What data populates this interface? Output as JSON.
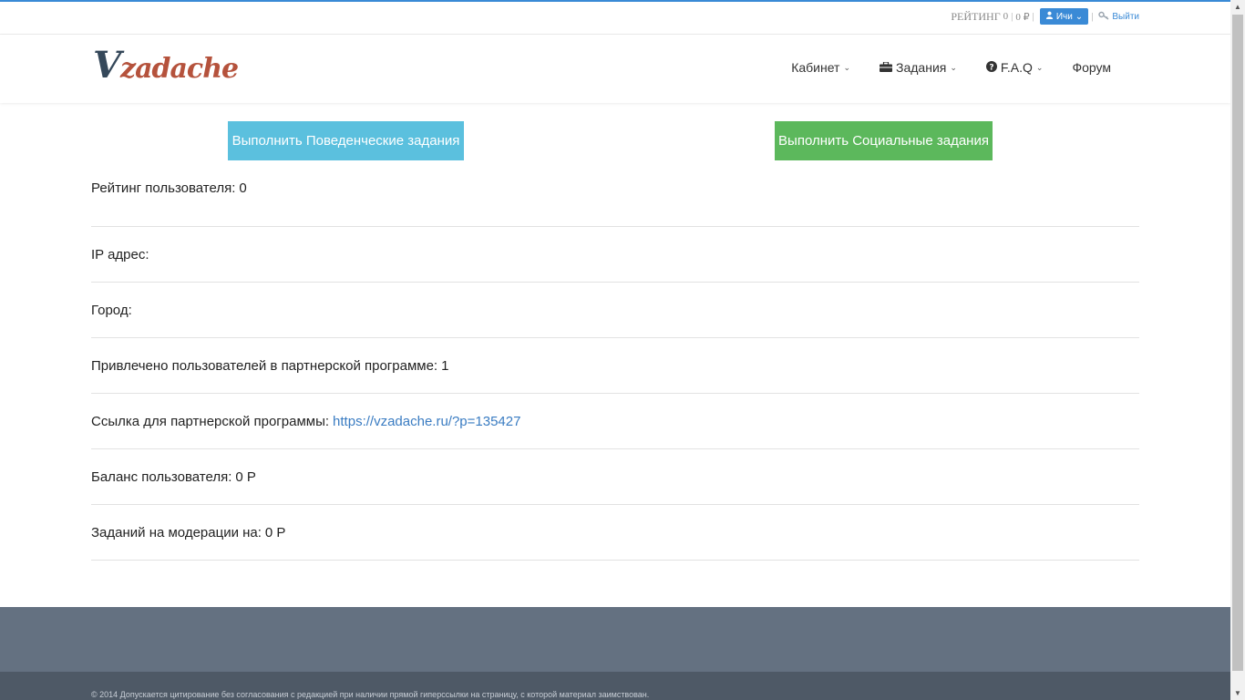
{
  "topbar": {
    "rating_label": "РЕЙТИНГ",
    "rating_value": "0",
    "balance_value": "0 ₽",
    "user_name": "Ичи",
    "logout_label": "Выйти"
  },
  "logo": {
    "first": "V",
    "rest": "zadache"
  },
  "nav": [
    {
      "label": "Кабинет"
    },
    {
      "label": "Задания"
    },
    {
      "label": "F.A.Q"
    },
    {
      "label": "Форум"
    }
  ],
  "actions": {
    "behavior_label": "Выполнить Поведенческие задания",
    "social_label": "Выполнить Социальные задания"
  },
  "info": {
    "rating_label": "Рейтинг пользователя:",
    "rating_value": "0",
    "ip_label": "IP адрес:",
    "city_label": "Город:",
    "referred_label": "Привлечено пользователей в партнерской программе:",
    "referred_value": "1",
    "ref_link_label": "Ссылка для партнерской программы:",
    "ref_link_value": "https://vzadache.ru/?p=135427",
    "balance_label": "Баланс пользователя:",
    "balance_value": "0 Р",
    "moderation_label": "Заданий на модерации на:",
    "moderation_value": "0 Р"
  },
  "footer": {
    "copyright": "© 2014 Допускается цитирование без согласования с редакцией при наличии прямой гиперссылки на страницу, с которой материал заимствован."
  },
  "colors": {
    "accent": "#3a8ad6",
    "behavior_button": "#5bc0de",
    "social_button": "#5cb85c",
    "footer_top": "#647181",
    "footer_bottom": "#4e5966",
    "logo_v": "#35485a",
    "logo_rest": "#b5523c"
  }
}
